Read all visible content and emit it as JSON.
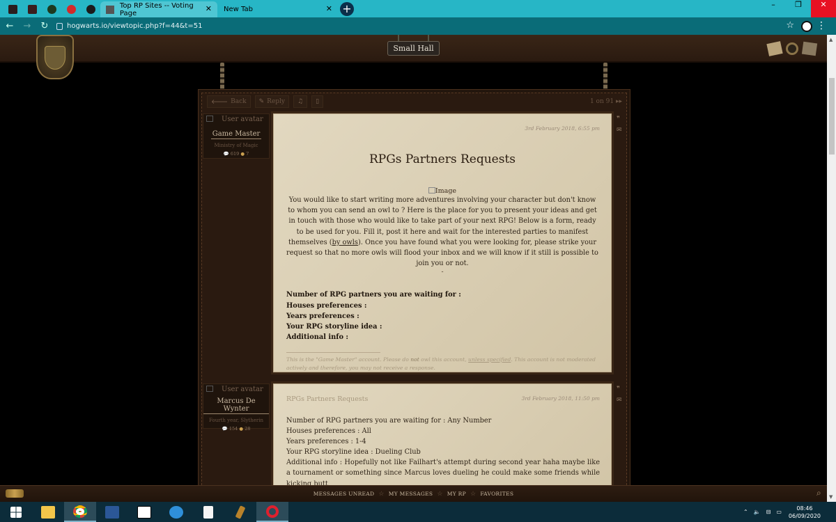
{
  "browser": {
    "tabs": [
      {
        "title": "Top RP Sites -- Voting Page",
        "close": "✕"
      },
      {
        "title": "New Tab",
        "close": "✕"
      }
    ],
    "new_tab": "+",
    "url": "hogwarts.io/viewtopic.php?f=44&t=51",
    "star": "☆",
    "menu": "⋮",
    "window_controls": [
      "–",
      "❐",
      "✕"
    ]
  },
  "site": {
    "hall_label": "Small Hall",
    "actions": [
      {
        "icon": "arrow-left-icon",
        "label": "Back"
      },
      {
        "icon": "pencil-icon",
        "label": "Reply"
      }
    ],
    "pager": "1 on 91",
    "pager_next": "▸▸",
    "posts": [
      {
        "avatar_alt": "User avatar",
        "username": "Game Master",
        "rank": "Ministry of Magic",
        "stat_posts": "619",
        "stat_coins": "7",
        "date": "3rd February 2018, 6:55 pm",
        "title": "RPGs Partners Requests",
        "image_alt": "Image",
        "body_pre": "You would like to start writing more adventures involving your character but don't know to whom you can send an owl to ? Here is the place for you to present your ideas and get in touch with those who would like to take part of your next RPG! Below is a form, ready to be used for you. Fill it, post it here and wait for the interested parties to manifest themselves (",
        "body_link": "by owls",
        "body_post": "). Once you have found what you were looking for, please strike your request so that no more owls will flood your inbox and we will know if it still is possible to join you or not.",
        "dash": "-",
        "fields": [
          "Number of RPG partners you are waiting for :",
          "Houses preferences :",
          "Years preferences :",
          "Your RPG storyline idea :",
          "Additional info :"
        ],
        "sig_pre": "This is the \"Game Master\" account. Please do ",
        "sig_not": "not",
        "sig_mid": " owl this account, ",
        "sig_link": "unless specified",
        "sig_post": ". This account is not moderated actively and therefore, you may not receive a response."
      },
      {
        "avatar_alt": "User avatar",
        "username": "Marcus De Wynter",
        "rank": "Fourth year, Slytherin",
        "stat_posts": "154",
        "stat_coins": "28",
        "date": "3rd February 2018, 11:50 pm",
        "title": "RPGs Partners Requests",
        "lines": [
          "Number of RPG partners you are waiting for : Any Number",
          "Houses preferences : All",
          "Years preferences : 1-4",
          "Your RPG storyline idea : Dueling Club",
          "Additional info : Hopefully not like Failhart's attempt during second year haha maybe like a tournament or something since Marcus loves dueling he could make some friends while kicking butt"
        ]
      }
    ],
    "bottom_nav": [
      "MESSAGES UNREAD",
      "MY MESSAGES",
      "MY RP",
      "FAVORITES"
    ]
  },
  "taskbar": {
    "time": "08:46",
    "date": "06/09/2020"
  }
}
